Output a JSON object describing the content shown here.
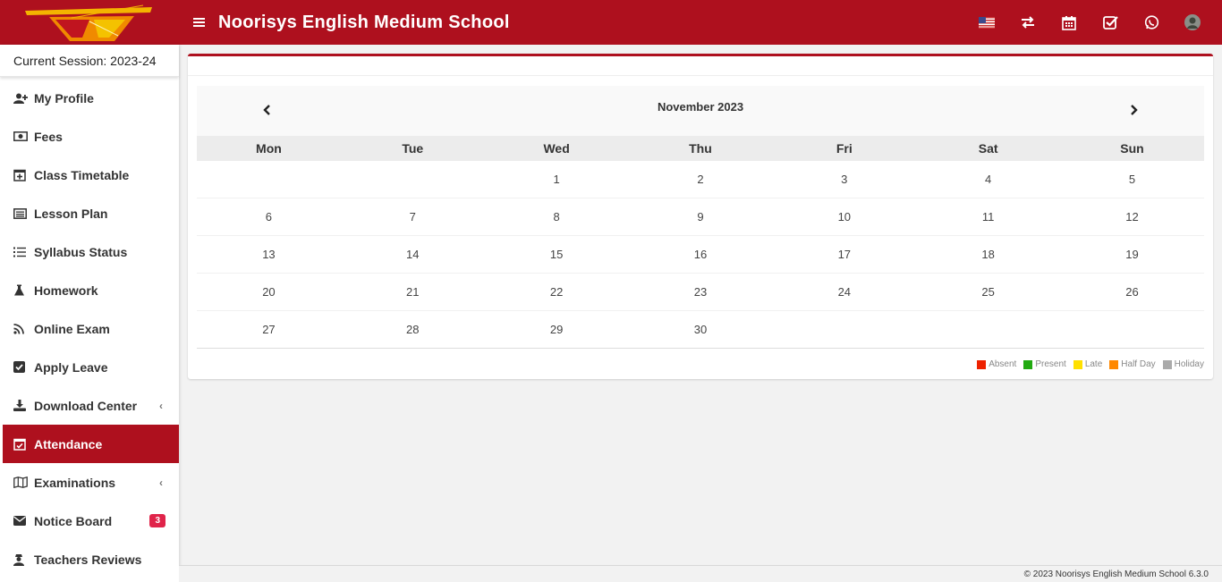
{
  "header": {
    "title": "Noorisys English Medium School",
    "icons": [
      "language-flag-icon",
      "switch-icon",
      "calendar-icon",
      "tasks-icon",
      "whatsapp-icon",
      "user-avatar"
    ]
  },
  "sidebar": {
    "session": "Current Session: 2023-24",
    "items": [
      {
        "label": "My Profile",
        "icon": "user-plus-icon"
      },
      {
        "label": "Fees",
        "icon": "money-icon"
      },
      {
        "label": "Class Timetable",
        "icon": "calendar-plus-icon"
      },
      {
        "label": "Lesson Plan",
        "icon": "list-alt-icon"
      },
      {
        "label": "Syllabus Status",
        "icon": "list-icon"
      },
      {
        "label": "Homework",
        "icon": "flask-icon"
      },
      {
        "label": "Online Exam",
        "icon": "rss-icon"
      },
      {
        "label": "Apply Leave",
        "icon": "check-square-icon"
      },
      {
        "label": "Download Center",
        "icon": "download-icon"
      },
      {
        "label": "Attendance",
        "icon": "calendar-check-icon"
      },
      {
        "label": "Examinations",
        "icon": "map-icon"
      },
      {
        "label": "Notice Board",
        "icon": "envelope-icon",
        "badge": "3"
      },
      {
        "label": "Teachers Reviews",
        "icon": "user-secret-icon"
      }
    ]
  },
  "calendar": {
    "month": "November 2023",
    "days": [
      "Mon",
      "Tue",
      "Wed",
      "Thu",
      "Fri",
      "Sat",
      "Sun"
    ],
    "weeks": [
      [
        "",
        "",
        "1",
        "2",
        "3",
        "4",
        "5"
      ],
      [
        "6",
        "7",
        "8",
        "9",
        "10",
        "11",
        "12"
      ],
      [
        "13",
        "14",
        "15",
        "16",
        "17",
        "18",
        "19"
      ],
      [
        "20",
        "21",
        "22",
        "23",
        "24",
        "25",
        "26"
      ],
      [
        "27",
        "28",
        "29",
        "30",
        "",
        "",
        ""
      ]
    ],
    "legend": [
      {
        "label": "Absent",
        "color": "#ee2200"
      },
      {
        "label": "Present",
        "color": "#22aa11"
      },
      {
        "label": "Late",
        "color": "#ffe000"
      },
      {
        "label": "Half Day",
        "color": "#ff8800"
      },
      {
        "label": "Holiday",
        "color": "#aaaaaa"
      }
    ]
  },
  "footer": {
    "text": "© 2023 Noorisys English Medium School 6.3.0"
  },
  "colors": {
    "brand": "#ae101e",
    "badge": "#e0244a"
  }
}
